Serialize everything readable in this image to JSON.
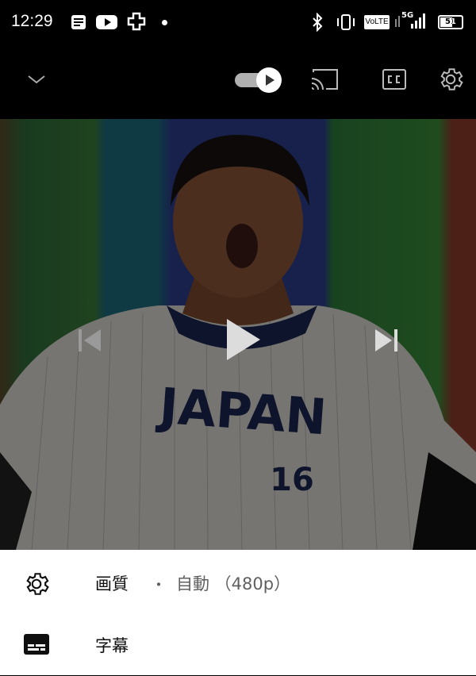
{
  "status_bar": {
    "time": "12:29",
    "volte": "VoLTE",
    "network": "5G",
    "battery": "51",
    "icons": [
      "notes-icon",
      "youtube-icon",
      "medical-cross-icon",
      "bluetooth-icon",
      "vibrate-icon",
      "signal-icon",
      "battery-icon"
    ]
  },
  "player": {
    "icons": [
      "chevron-down-icon",
      "autoplay-toggle-icon",
      "cast-icon",
      "captions-icon",
      "settings-icon"
    ],
    "autoplay_on": true,
    "controls": [
      "previous-icon",
      "play-icon",
      "next-icon"
    ],
    "jersey_text": "JAPAN",
    "jersey_number": "16"
  },
  "settings_sheet": {
    "quality_label": "画質",
    "quality_separator": "・",
    "quality_value": "自動 （480p）",
    "captions_label": "字幕"
  }
}
